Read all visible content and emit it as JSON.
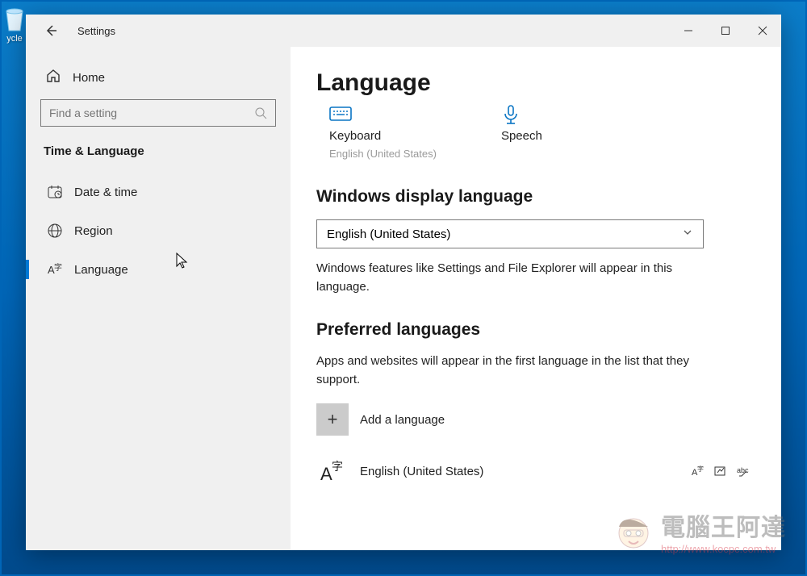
{
  "desktop": {
    "recycle_label": "ycle"
  },
  "window": {
    "title": "Settings"
  },
  "sidebar": {
    "home": "Home",
    "search_placeholder": "Find a setting",
    "category": "Time & Language",
    "items": [
      {
        "label": "Date & time"
      },
      {
        "label": "Region"
      },
      {
        "label": "Language"
      }
    ]
  },
  "main": {
    "title": "Language",
    "cards": {
      "keyboard": {
        "label": "Keyboard",
        "sub": "English (United States)"
      },
      "speech": {
        "label": "Speech"
      }
    },
    "display_heading": "Windows display language",
    "display_selected": "English (United States)",
    "display_desc": "Windows features like Settings and File Explorer will appear in this language.",
    "preferred_heading": "Preferred languages",
    "preferred_desc": "Apps and websites will appear in the first language in the list that they support.",
    "add_language": "Add a language",
    "entries": [
      {
        "label": "English (United States)"
      }
    ]
  },
  "watermark": {
    "brand": "電腦王阿達",
    "url": "http://www.kocpc.com.tw"
  }
}
